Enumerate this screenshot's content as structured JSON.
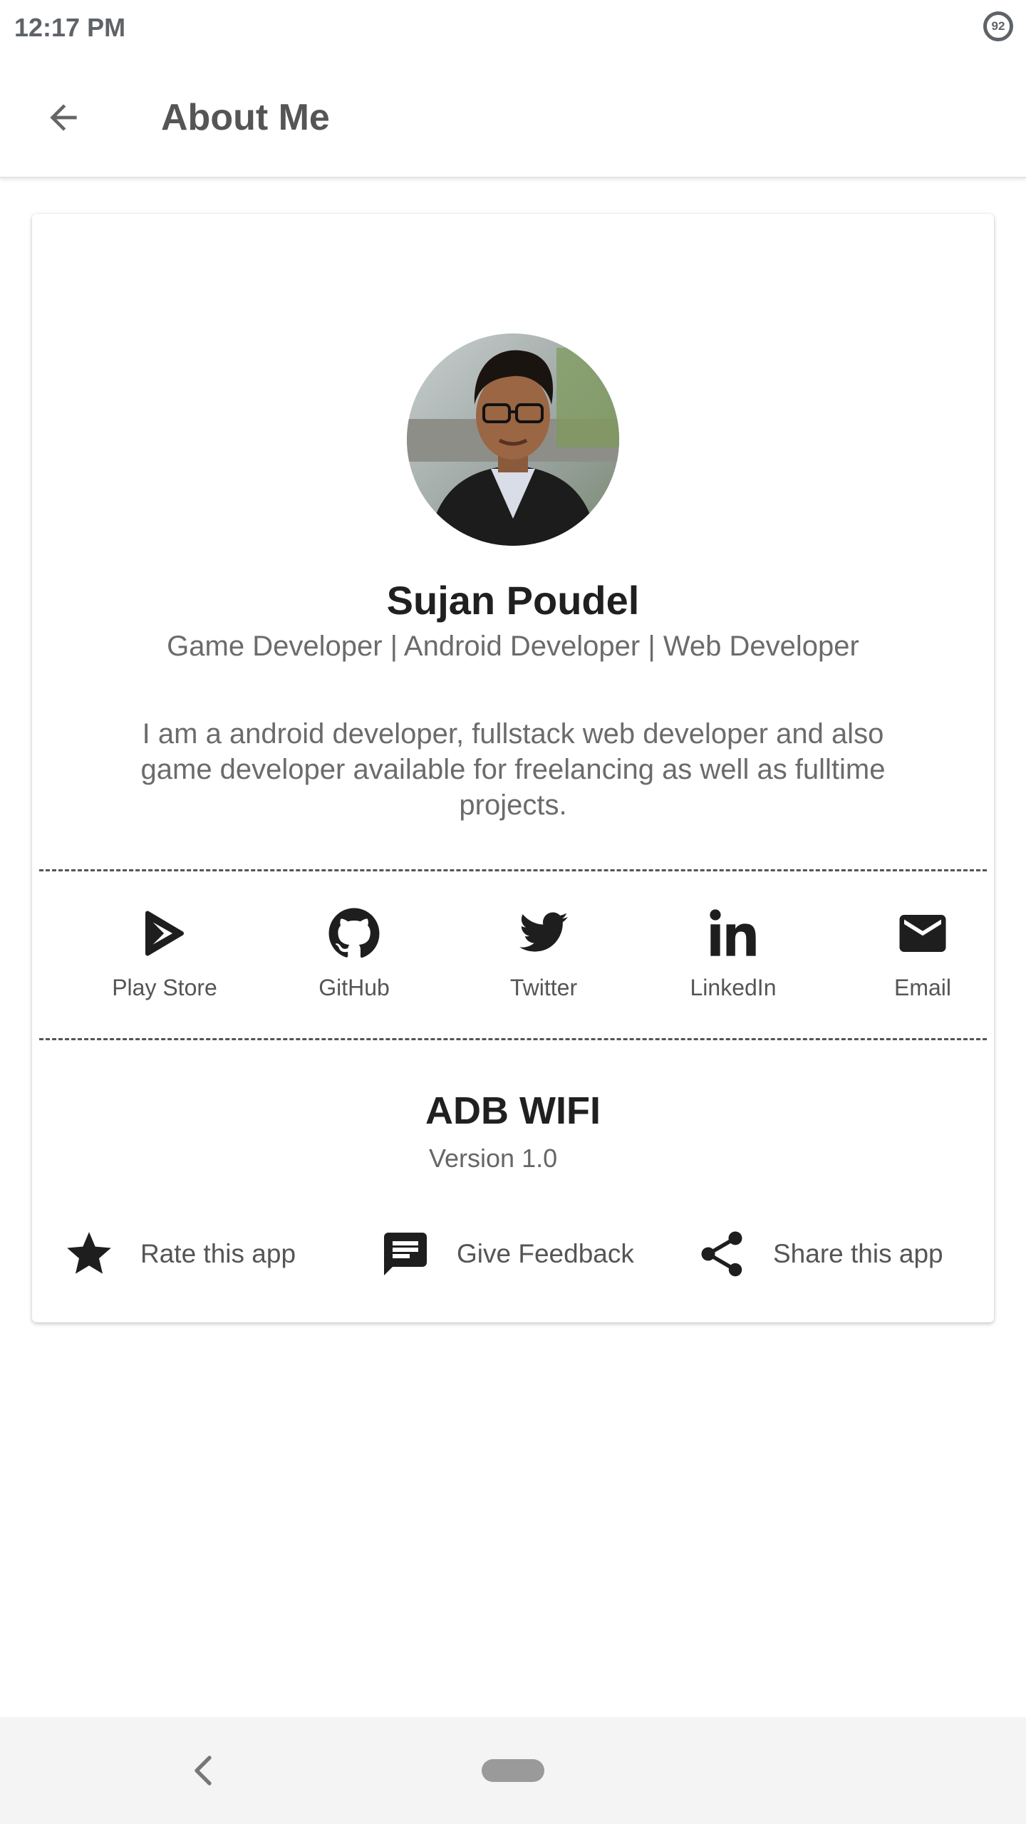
{
  "status_bar": {
    "time": "12:17 PM",
    "battery": "92"
  },
  "app_bar": {
    "title": "About Me"
  },
  "profile": {
    "name": "Sujan Poudel",
    "roles": "Game Developer | Android Developer | Web Developer",
    "bio": "I am a android developer, fullstack web developer and also game developer available for freelancing as well as fulltime projects."
  },
  "social": [
    {
      "label": "Play Store",
      "icon": "play-store-icon"
    },
    {
      "label": "GitHub",
      "icon": "github-icon"
    },
    {
      "label": "Twitter",
      "icon": "twitter-icon"
    },
    {
      "label": "LinkedIn",
      "icon": "linkedin-icon"
    },
    {
      "label": "Email",
      "icon": "email-icon"
    }
  ],
  "app": {
    "name": "ADB WIFI",
    "version": "Version 1.0"
  },
  "actions": [
    {
      "label": "Rate this app",
      "icon": "star-icon"
    },
    {
      "label": "Give Feedback",
      "icon": "feedback-icon"
    },
    {
      "label": "Share this app",
      "icon": "share-icon"
    }
  ],
  "colors": {
    "text_dark": "#202020",
    "text_muted": "#6b6b6b",
    "icon": "#1e1e1e"
  }
}
